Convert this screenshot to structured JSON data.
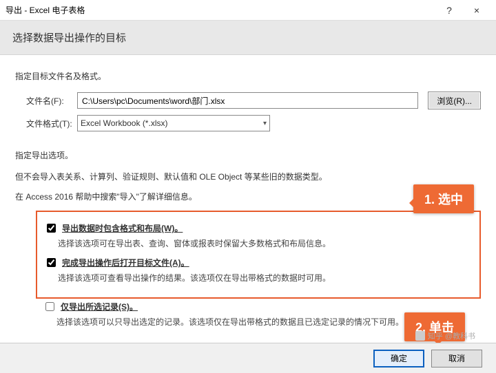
{
  "titlebar": {
    "title": "导出 - Excel 电子表格",
    "help": "?",
    "close": "×"
  },
  "subheader": "选择数据导出操作的目标",
  "section1_label": "指定目标文件名及格式。",
  "filename": {
    "label": "文件名(F):",
    "value": "C:\\Users\\pc\\Documents\\word\\部门.xlsx",
    "browse": "浏览(R)..."
  },
  "fileformat": {
    "label": "文件格式(T):",
    "value": "Excel Workbook (*.xlsx)"
  },
  "section2_label": "指定导出选项。",
  "para1_a": "但不会导入表关系、计算列、验证规则、默认值和 OLE Object 等某些旧的数据",
  "para1_b": "类型。",
  "para2": "在 Access 2016 帮助中搜索\"导入\"了解详细信息。",
  "opt1": {
    "checked": true,
    "label": "导出数据时包含格式和布局(W)。",
    "sub": "选择该选项可在导出表、查询、窗体或报表时保留大多数格式和布局信息。"
  },
  "opt2": {
    "checked": true,
    "label": "完成导出操作后打开目标文件(A)。",
    "sub": "选择该选项可查看导出操作的结果。该选项仅在导出带格式的数据时可用。"
  },
  "opt3": {
    "checked": false,
    "label": "仅导出所选记录(S)。",
    "sub": "选择该选项可以只导出选定的记录。该选项仅在导出带格式的数据且已选定记录的情况下可用。"
  },
  "callout1": "1. 选中",
  "callout2": "2. 单击",
  "buttons": {
    "ok": "确定",
    "cancel": "取消"
  },
  "watermark": "知乎 @教科书"
}
